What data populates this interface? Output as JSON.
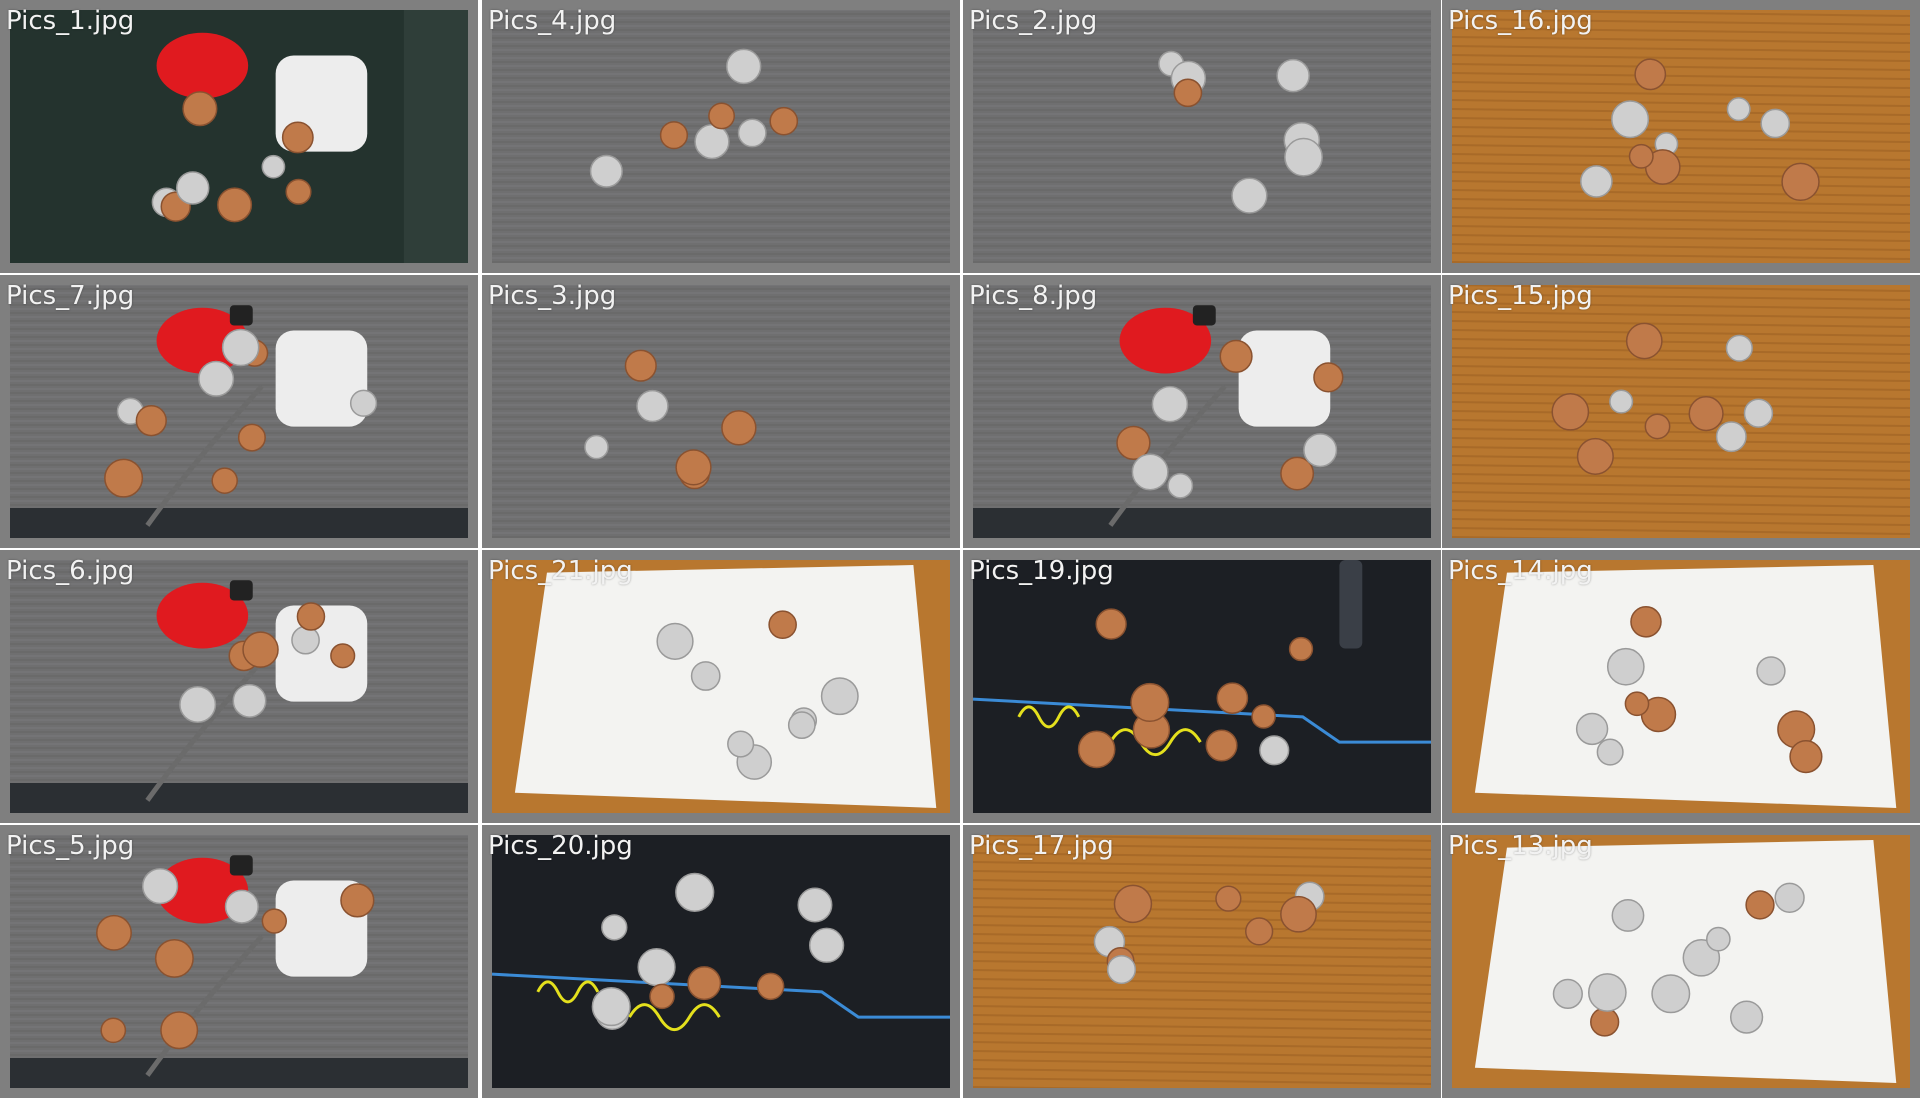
{
  "tiles": [
    {
      "label": "Pics_1.jpg",
      "bg": "dark-mat",
      "props": [
        "red-pouch",
        "earbuds-case"
      ],
      "coins": 8
    },
    {
      "label": "Pics_4.jpg",
      "bg": "gray-fabric",
      "props": [],
      "coins": 7
    },
    {
      "label": "Pics_2.jpg",
      "bg": "gray-fabric",
      "props": [],
      "coins": 7
    },
    {
      "label": "Pics_16.jpg",
      "bg": "wood",
      "props": [],
      "coins": 9
    },
    {
      "label": "Pics_7.jpg",
      "bg": "gray-case",
      "props": [
        "red-pouch",
        "earbuds-case",
        "keys",
        "strap"
      ],
      "coins": 9
    },
    {
      "label": "Pics_3.jpg",
      "bg": "gray-fabric",
      "props": [],
      "coins": 6
    },
    {
      "label": "Pics_8.jpg",
      "bg": "gray-case",
      "props": [
        "red-pouch",
        "earbuds-case",
        "keys",
        "strap"
      ],
      "coins": 8
    },
    {
      "label": "Pics_15.jpg",
      "bg": "wood",
      "props": [],
      "coins": 9
    },
    {
      "label": "Pics_6.jpg",
      "bg": "gray-case",
      "props": [
        "red-pouch",
        "earbuds-case",
        "keys",
        "strap"
      ],
      "coins": 7
    },
    {
      "label": "Pics_21.jpg",
      "bg": "napkin-wood",
      "props": [],
      "coins": 8
    },
    {
      "label": "Pics_19.jpg",
      "bg": "black-mat",
      "props": [
        "handwriting",
        "pen"
      ],
      "coins": 9
    },
    {
      "label": "Pics_14.jpg",
      "bg": "napkin-wood",
      "props": [],
      "coins": 9
    },
    {
      "label": "Pics_5.jpg",
      "bg": "gray-case",
      "props": [
        "red-pouch",
        "earbuds-case",
        "keys",
        "strap"
      ],
      "coins": 8
    },
    {
      "label": "Pics_20.jpg",
      "bg": "black-mat",
      "props": [
        "handwriting"
      ],
      "coins": 10
    },
    {
      "label": "Pics_17.jpg",
      "bg": "wood",
      "props": [],
      "coins": 8
    },
    {
      "label": "Pics_13.jpg",
      "bg": "napkin-wood",
      "props": [],
      "coins": 10
    }
  ],
  "colors": {
    "frame": "#7f7f7f",
    "caption": "#f2f2f2",
    "copper": "#c07a4a",
    "silver": "#cfcfcf",
    "wood": "#b8772f",
    "gray_fabric": "#6f6f70",
    "dark_mat": "#24332e",
    "black_mat": "#1c1f24",
    "napkin": "#f3f3f1",
    "red_pouch": "#e01a1f"
  }
}
